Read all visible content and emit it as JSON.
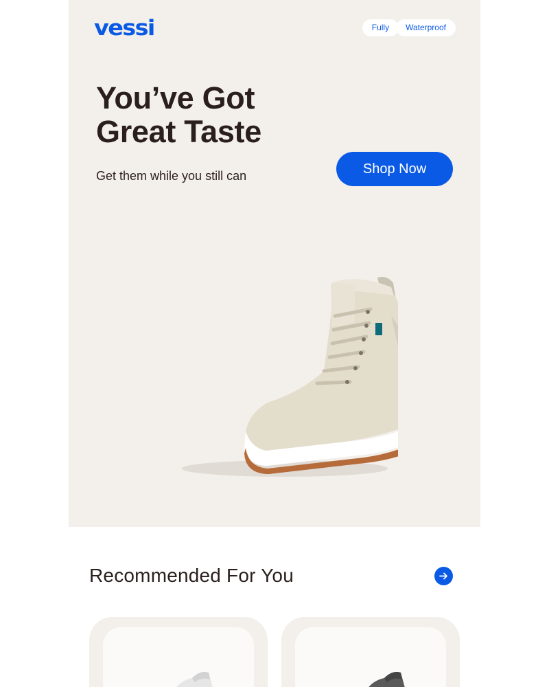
{
  "brand": {
    "logo_text": "vessi"
  },
  "badge": {
    "part1": "Fully",
    "part2": "Waterproof"
  },
  "hero": {
    "headline_line1": "You’ve Got",
    "headline_line2": "Great Taste",
    "subhead": "Get them while you still can",
    "cta_label": "Shop Now",
    "image": "cream-high-top-boot"
  },
  "recommended": {
    "title": "Recommended For You",
    "arrow_icon": "arrow-right-icon",
    "products": [
      {
        "image": "light-grey-sneaker"
      },
      {
        "image": "dark-grey-sneaker"
      }
    ]
  },
  "colors": {
    "brand_blue": "#0a5ae6",
    "hero_bg": "#f3efea",
    "text_dark": "#2a1f1c"
  }
}
